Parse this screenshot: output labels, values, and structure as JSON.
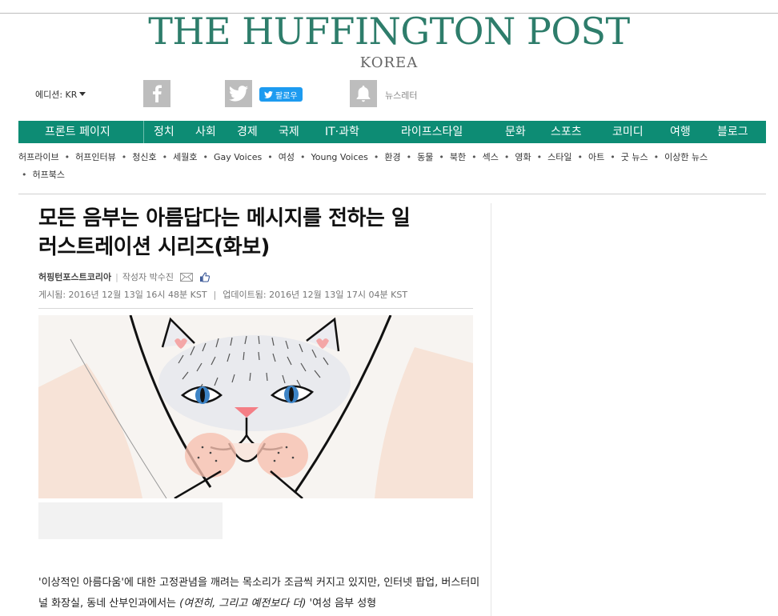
{
  "masthead": {
    "logo": "THE HUFFINGTON POST",
    "edition": "KOREA"
  },
  "topbar": {
    "edition_label": "에디션: KR",
    "follow_label": "팔로우",
    "newsletter_label": "뉴스레터"
  },
  "nav": {
    "items": [
      "프론트 페이지",
      "정치",
      "사회",
      "경제",
      "국제",
      "IT·과학",
      "라이프스타일",
      "문화",
      "스포츠",
      "코미디",
      "여행",
      "블로그"
    ]
  },
  "subnav": {
    "items": [
      "허프라이브",
      "허프인터뷰",
      "청신호",
      "세월호",
      "Gay Voices",
      "여성",
      "Young Voices",
      "환경",
      "동물",
      "북한",
      "섹스",
      "영화",
      "스타일",
      "아트",
      "굿 뉴스",
      "이상한 뉴스",
      "허프북스"
    ]
  },
  "article": {
    "headline_line1": "모든 음부는 아름답다는 메시지를 전하는 일",
    "headline_line2": "러스트레이션 시리즈(화보)",
    "byline_org": "허핑턴포스트코리아",
    "byline_author": "작성자 박수진",
    "posted": "게시됨: 2016년 12월 13일 16시 48분 KST",
    "updated": "업데이트됨: 2016년 12월 13일 17시 04분 KST",
    "body_part1": "'이상적인 아름다움'에 대한 고정관념을 깨려는 목소리가 조금씩 커지고 있지만, 인터넷 팝업, 버스터미널 화장실, 동네 산부인과에서는 ",
    "body_em": "(여전히, 그리고 예전보다 더)",
    "body_part2": " '여성 음부 성형"
  },
  "colors": {
    "brand_green": "#0d8c74",
    "logo_green": "#2e7d6b",
    "twitter_blue": "#1d9bf0"
  },
  "icons": [
    "facebook-icon",
    "twitter-icon",
    "bell-icon",
    "email-icon",
    "like-icon",
    "caret-down-icon"
  ]
}
